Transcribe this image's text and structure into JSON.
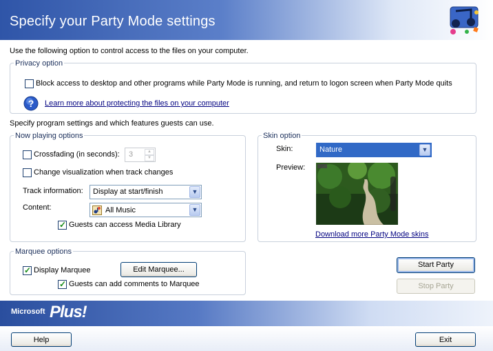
{
  "header": {
    "title": "Specify your Party Mode settings"
  },
  "intro_text": "Use the following option to control access to the files on your computer.",
  "privacy": {
    "legend": "Privacy option",
    "block_label": "Block access to desktop and other programs while Party Mode is running, and return to logon screen when Party Mode quits",
    "block_checked": false,
    "learn_more_link": "Learn more about protecting the files on your computer",
    "help_icon": "question-icon"
  },
  "settings_text": "Specify program settings and which features guests can use.",
  "now_playing": {
    "legend": "Now playing options",
    "crossfading_label": "Crossfading (in seconds):",
    "crossfading_checked": false,
    "crossfading_value": "3",
    "visualization_label": "Change visualization when track changes",
    "visualization_checked": false,
    "track_info_label": "Track information:",
    "track_info_value": "Display at start/finish",
    "content_label": "Content:",
    "content_value": "All Music",
    "guests_library_label": "Guests can access Media Library",
    "guests_library_checked": true
  },
  "skin": {
    "legend": "Skin option",
    "skin_label": "Skin:",
    "skin_value": "Nature",
    "preview_label": "Preview:",
    "download_link": "Download more Party Mode skins"
  },
  "marquee": {
    "legend": "Marquee options",
    "display_label": "Display Marquee",
    "display_checked": true,
    "edit_button": "Edit Marquee...",
    "comments_label": "Guests can add comments to Marquee",
    "comments_checked": true
  },
  "actions": {
    "start_party": "Start Party",
    "stop_party": "Stop Party"
  },
  "footer": {
    "brand_small": "Microsoft",
    "brand_large": "Plus!",
    "help": "Help",
    "exit": "Exit"
  },
  "colors": {
    "header_blue": "#2f55a8",
    "link": "#000080",
    "check_green": "#168a16"
  }
}
